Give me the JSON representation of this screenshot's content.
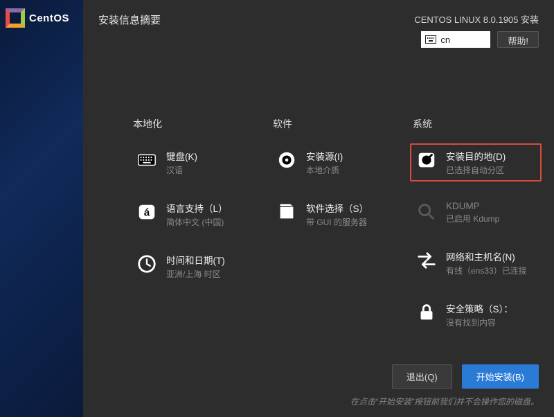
{
  "logo_text": "CentOS",
  "page_title": "安装信息摘要",
  "product_line": "CENTOS LINUX 8.0.1905 安装",
  "lang_indicator": "cn",
  "help_label": "帮助!",
  "columns": {
    "local": {
      "header": "本地化",
      "keyboard": {
        "title": "键盘(K)",
        "sub": "汉语"
      },
      "language": {
        "title": "语言支持（L）",
        "sub": "简体中文 (中国)"
      },
      "datetime": {
        "title": "时间和日期(T)",
        "sub": "亚洲/上海 时区"
      }
    },
    "software": {
      "header": "软件",
      "source": {
        "title": "安装源(I)",
        "sub": "本地介质"
      },
      "selection": {
        "title": "软件选择（S）",
        "sub": "带 GUI 的服务器"
      }
    },
    "system": {
      "header": "系统",
      "destination": {
        "title": "安装目的地(D)",
        "sub": "已选择自动分区"
      },
      "kdump": {
        "title": "KDUMP",
        "sub": "已启用 Kdump"
      },
      "network": {
        "title": "网络和主机名(N)",
        "sub": "有线（ens33）已连接"
      },
      "security": {
        "title": "安全策略（S）：",
        "sub": "没有找到内容"
      }
    }
  },
  "buttons": {
    "quit": "退出(Q)",
    "begin": "开始安装(B)"
  },
  "footer_hint": "在点击“开始安装”按钮前我们并不会操作您的磁盘。",
  "watermark": ""
}
